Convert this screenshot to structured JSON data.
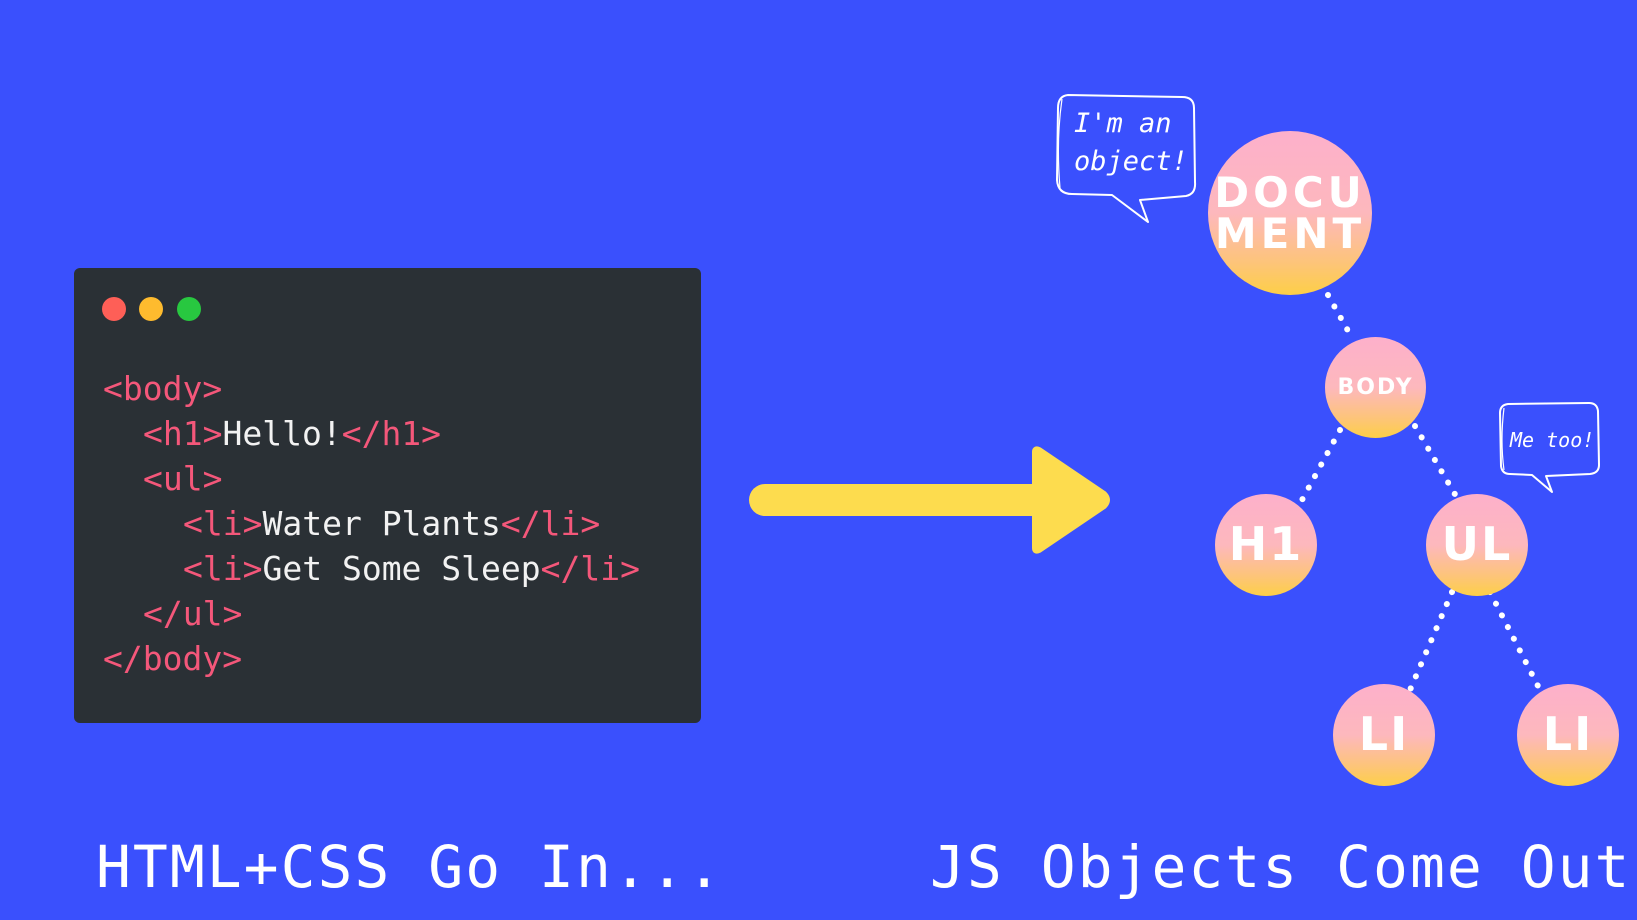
{
  "code_window": {
    "buttons": [
      "close",
      "minimize",
      "maximize"
    ],
    "lines": [
      [
        {
          "t": "tag",
          "v": "<body>"
        }
      ],
      [
        {
          "t": "tag",
          "v": "<h1>"
        },
        {
          "t": "txt",
          "v": "Hello!"
        },
        {
          "t": "tag",
          "v": "</h1>"
        }
      ],
      [
        {
          "t": "tag",
          "v": "<ul>"
        }
      ],
      [
        {
          "t": "tag",
          "v": "<li>"
        },
        {
          "t": "txt",
          "v": "Water Plants"
        },
        {
          "t": "tag",
          "v": "</li>"
        }
      ],
      [
        {
          "t": "tag",
          "v": "<li>"
        },
        {
          "t": "txt",
          "v": "Get Some Sleep"
        },
        {
          "t": "tag",
          "v": "</li>"
        }
      ],
      [
        {
          "t": "tag",
          "v": "</ul>"
        }
      ],
      [
        {
          "t": "tag",
          "v": "</body>"
        }
      ]
    ],
    "indents": [
      0,
      1,
      1,
      2,
      2,
      1,
      0
    ]
  },
  "tree": {
    "document": {
      "line1": "DOCU",
      "line2": "MENT"
    },
    "body": "BODY",
    "h1": "H1",
    "ul": "UL",
    "li_1": "LI",
    "li_2": "LI"
  },
  "bubbles": {
    "document_bubble": {
      "line1": "I'm an",
      "line2": "object!"
    },
    "ul_bubble": "Me too!"
  },
  "captions": {
    "left": "HTML+CSS Go In...",
    "right": "JS Objects Come Out"
  },
  "colors": {
    "background": "#3a50fd",
    "code_bg": "#2a3035",
    "tag": "#f4577a",
    "arrow": "#fddc4e",
    "node_top": "#fdb0cb",
    "node_bottom": "#fdcf47"
  }
}
